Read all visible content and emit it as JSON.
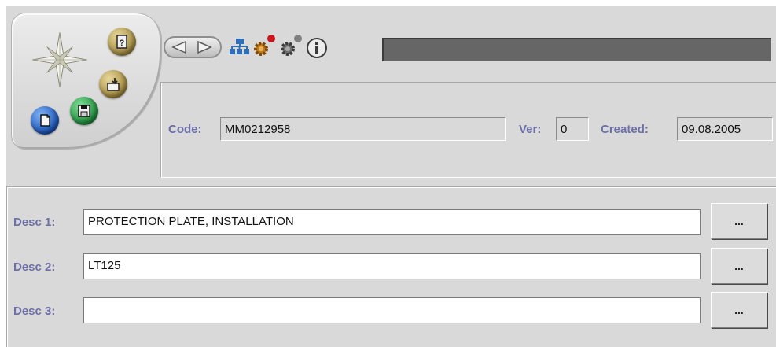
{
  "colors": {
    "label": "#6d6fa8",
    "panel": "#d9d9d9",
    "statusbar": "#666666"
  },
  "pod": {
    "icons": [
      "compass-star-icon",
      "help-icon",
      "export-icon",
      "save-icon",
      "new-document-icon"
    ]
  },
  "toolbar": {
    "icons": [
      "back-arrow-icon",
      "forward-arrow-icon",
      "hierarchy-icon",
      "gear-red-icon",
      "gear-gray-icon",
      "info-icon"
    ]
  },
  "header": {
    "code_label": "Code:",
    "code_value": "MM0212958",
    "ver_label": "Ver:",
    "ver_value": "0",
    "created_label": "Created:",
    "created_value": "09.08.2005"
  },
  "descriptions": [
    {
      "label": "Desc 1:",
      "value": "PROTECTION PLATE, INSTALLATION",
      "button": "..."
    },
    {
      "label": "Desc 2:",
      "value": "LT125",
      "button": "..."
    },
    {
      "label": "Desc 3:",
      "value": "",
      "button": "..."
    }
  ]
}
